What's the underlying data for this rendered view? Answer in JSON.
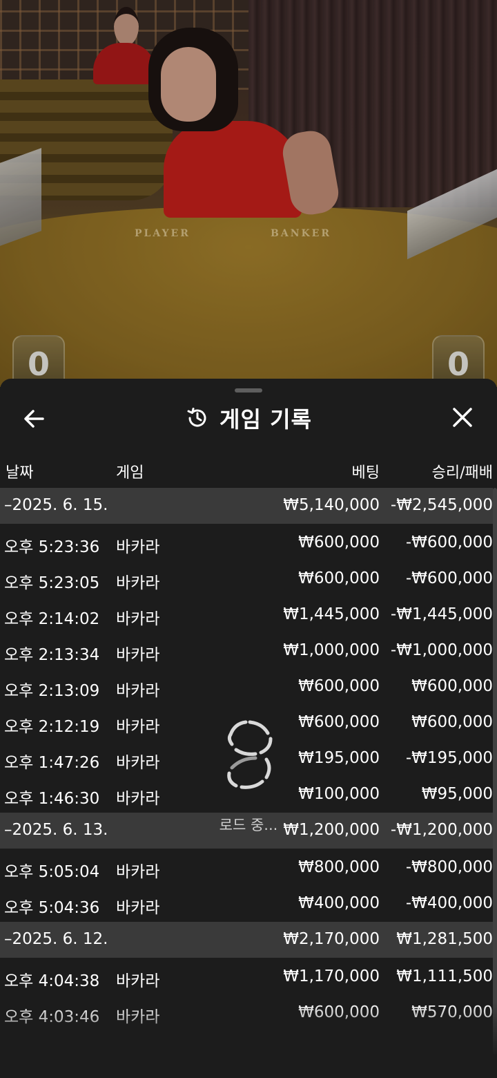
{
  "video": {
    "table_labels": [
      "PLAYER",
      "BANKER"
    ],
    "player_score": "0",
    "banker_score": "0"
  },
  "panel": {
    "title": "게임 기록",
    "icons": {
      "back": "arrow-left-icon",
      "history": "history-icon",
      "close": "close-icon"
    }
  },
  "columns": {
    "date": "날짜",
    "game": "게임",
    "bet": "베팅",
    "result": "승리/패배"
  },
  "groups": [
    {
      "date": "–2025. 6. 15.",
      "bet": "₩5,140,000",
      "result": "-₩2,545,000",
      "rows": [
        {
          "time": "오후 5:23:36",
          "game": "바카라",
          "bet": "₩600,000",
          "result": "-₩600,000"
        },
        {
          "time": "오후 5:23:05",
          "game": "바카라",
          "bet": "₩600,000",
          "result": "-₩600,000"
        },
        {
          "time": "오후 2:14:02",
          "game": "바카라",
          "bet": "₩1,445,000",
          "result": "-₩1,445,000"
        },
        {
          "time": "오후 2:13:34",
          "game": "바카라",
          "bet": "₩1,000,000",
          "result": "-₩1,000,000"
        },
        {
          "time": "오후 2:13:09",
          "game": "바카라",
          "bet": "₩600,000",
          "result": "₩600,000"
        },
        {
          "time": "오후 2:12:19",
          "game": "바카라",
          "bet": "₩600,000",
          "result": "₩600,000"
        },
        {
          "time": "오후 1:47:26",
          "game": "바카라",
          "bet": "₩195,000",
          "result": "-₩195,000"
        },
        {
          "time": "오후 1:46:30",
          "game": "바카라",
          "bet": "₩100,000",
          "result": "₩95,000"
        }
      ]
    },
    {
      "date": "–2025. 6. 13.",
      "bet": "₩1,200,000",
      "result": "-₩1,200,000",
      "rows": [
        {
          "time": "오후 5:05:04",
          "game": "바카라",
          "bet": "₩800,000",
          "result": "-₩800,000"
        },
        {
          "time": "오후 5:04:36",
          "game": "바카라",
          "bet": "₩400,000",
          "result": "-₩400,000"
        }
      ]
    },
    {
      "date": "–2025. 6. 12.",
      "bet": "₩2,170,000",
      "result": "₩1,281,500",
      "rows": [
        {
          "time": "오후 4:04:38",
          "game": "바카라",
          "bet": "₩1,170,000",
          "result": "₩1,111,500"
        },
        {
          "time": "오후 4:03:46",
          "game": "바카라",
          "bet": "₩600,000",
          "result": "₩570,000"
        }
      ]
    }
  ],
  "loader": {
    "text": "로드 중...",
    "icon": "loading-spinner-icon"
  }
}
